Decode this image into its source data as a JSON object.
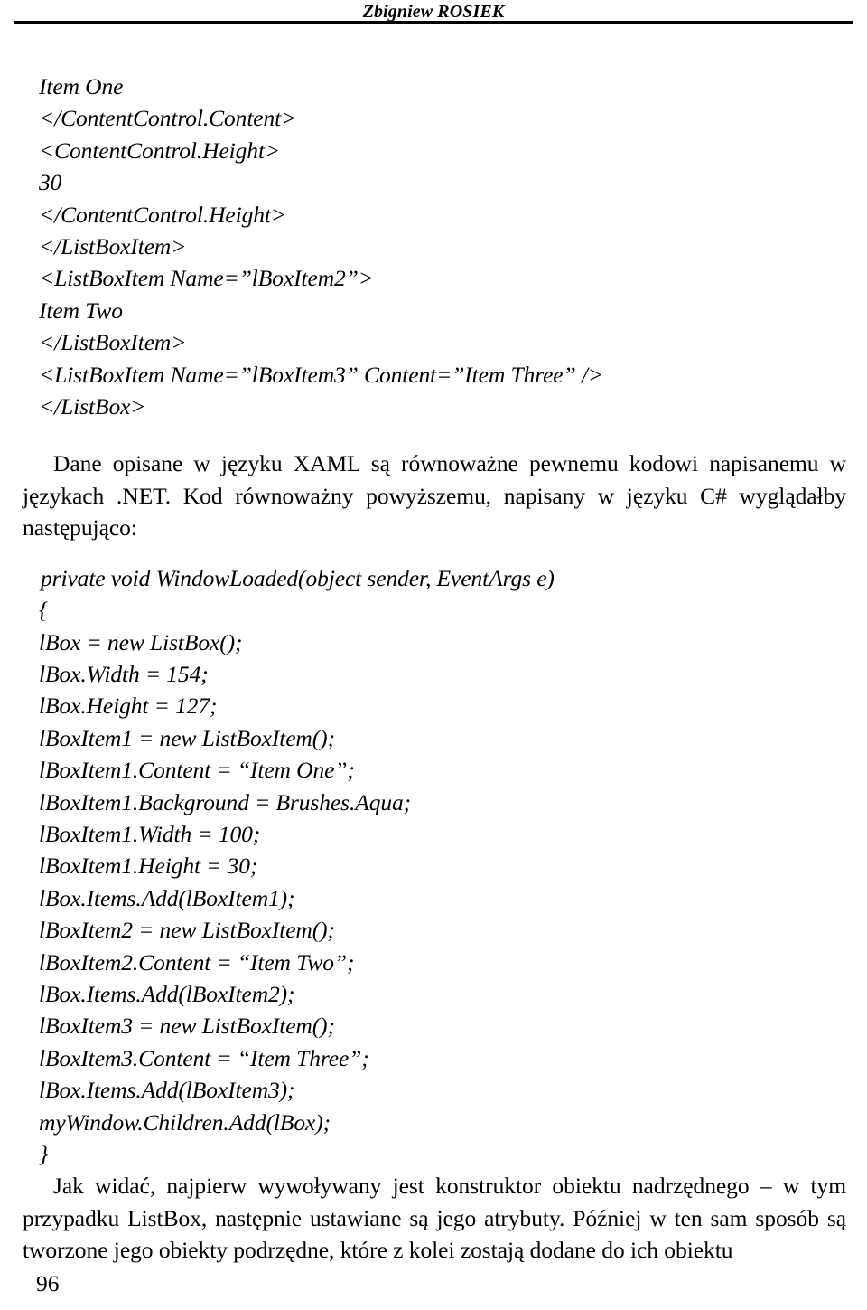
{
  "page": {
    "running_head": {
      "given_name": "Zbigniew",
      "family_name": "ROSIEK",
      "full": "Zbigniew ROSIEK"
    },
    "folio": "96"
  },
  "xaml_code": {
    "language": "XAML",
    "lines": [
      "Item One",
      "</ContentControl.Content>",
      "<ContentControl.Height>",
      "30",
      "</ContentControl.Height>",
      "</ListBoxItem>",
      "<ListBoxItem Name=”lBoxItem2”>",
      "Item Two",
      "</ListBoxItem>",
      "<ListBoxItem Name=”lBoxItem3” Content=”Item Three” />",
      "</ListBox>"
    ]
  },
  "paragraph_1": {
    "text": "Dane opisane w języku XAML są równoważne pewnemu kodowi napisanemu w językach .NET. Kod równoważny powyższemu, napisany w języku C# wyglądałby następująco:"
  },
  "csharp_code": {
    "language": "C#",
    "lines": [
      "private void WindowLoaded(object sender, EventArgs e)",
      "{",
      "lBox = new ListBox();",
      "lBox.Width = 154;",
      "lBox.Height = 127;",
      "lBoxItem1 = new ListBoxItem();",
      "lBoxItem1.Content = “Item One”;",
      "lBoxItem1.Background = Brushes.Aqua;",
      "lBoxItem1.Width = 100;",
      "lBoxItem1.Height = 30;",
      "lBox.Items.Add(lBoxItem1);",
      "lBoxItem2 = new ListBoxItem();",
      "lBoxItem2.Content = “Item Two”;",
      "lBox.Items.Add(lBoxItem2);",
      "lBoxItem3 = new ListBoxItem();",
      "lBoxItem3.Content = “Item Three”;",
      "lBox.Items.Add(lBoxItem3);",
      "myWindow.Children.Add(lBox);",
      "}"
    ]
  },
  "paragraph_2": {
    "text": "Jak widać, najpierw wywoływany jest konstruktor obiektu nadrzędnego – w tym przypadku ListBox, następnie ustawiane są jego atrybuty. Później w ten sam sposób są tworzone jego obiekty podrzędne, które z kolei zostają dodane do ich obiektu"
  }
}
